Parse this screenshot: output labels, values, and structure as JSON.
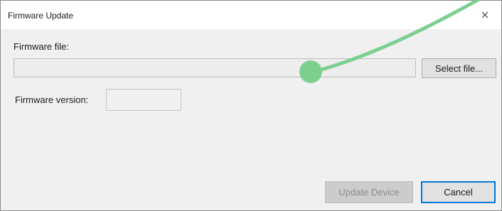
{
  "window": {
    "title": "Firmware Update",
    "close_glyph": "×"
  },
  "form": {
    "firmware_file_label": "Firmware file:",
    "firmware_file_value": "",
    "select_file_label": "Select file...",
    "firmware_version_label": "Firmware version:",
    "firmware_version_value": ""
  },
  "footer": {
    "update_device_label": "Update Device",
    "cancel_label": "Cancel"
  },
  "colors": {
    "cursor_trail": "#7ccf8f",
    "focus_border": "#0078d7"
  }
}
